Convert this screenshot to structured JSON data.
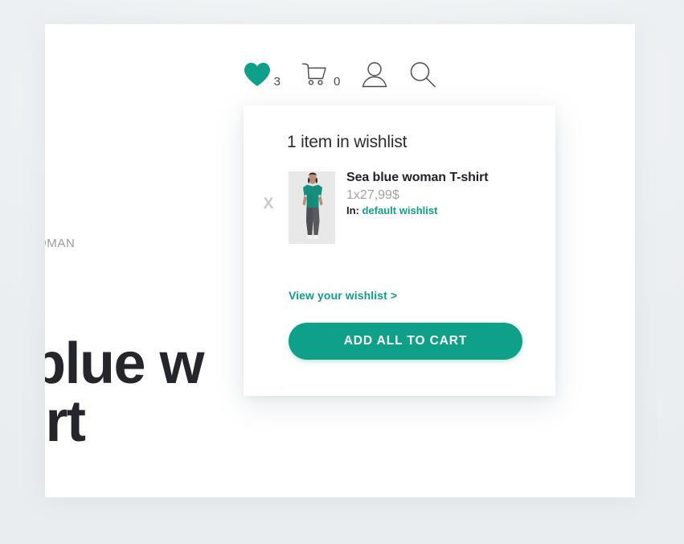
{
  "theme": {
    "accent": "#0fa089",
    "accent_link": "#0f9f89",
    "text_dark": "#1f2228",
    "text_muted": "#a0a2a6",
    "page_background": "#eef1f3",
    "card_background": "#ffffff"
  },
  "header": {
    "icons": [
      {
        "name": "wishlist-heart-icon",
        "count": "3"
      },
      {
        "name": "shopping-cart-icon",
        "count": "0"
      },
      {
        "name": "user-account-icon",
        "count": ""
      },
      {
        "name": "search-icon",
        "count": ""
      }
    ],
    "wishlist_count": "3",
    "cart_count": "0"
  },
  "product_page": {
    "breadcrumb": "OMAN",
    "title": "blue w\nirt"
  },
  "wishlist_panel": {
    "heading": "1 item in wishlist",
    "remove_label": "X",
    "item": {
      "name": "Sea blue woman T-shirt",
      "price": "1x27,99$",
      "list_label": "In:",
      "list_value": "default wishlist",
      "thumbnail_alt": "woman wearing sea blue t-shirt and grey trousers"
    },
    "view_link": "View your wishlist >",
    "add_all_button": "ADD ALL TO CART"
  }
}
